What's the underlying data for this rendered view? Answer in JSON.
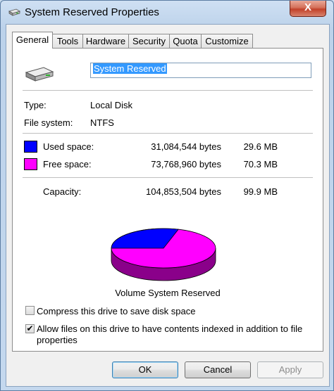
{
  "window": {
    "title": "System Reserved Properties",
    "close_glyph": "X"
  },
  "tabs": [
    {
      "label": "General",
      "active": true
    },
    {
      "label": "Tools"
    },
    {
      "label": "Hardware"
    },
    {
      "label": "Security"
    },
    {
      "label": "Quota"
    },
    {
      "label": "Customize"
    }
  ],
  "general": {
    "drive_name": "System Reserved",
    "type_label": "Type:",
    "type_value": "Local Disk",
    "fs_label": "File system:",
    "fs_value": "NTFS",
    "used": {
      "label": "Used space:",
      "bytes": "31,084,544 bytes",
      "size": "29.6 MB",
      "color": "#0000ff",
      "fraction": 0.296
    },
    "free": {
      "label": "Free space:",
      "bytes": "73,768,960 bytes",
      "size": "70.3 MB",
      "color": "#ff00ff",
      "fraction": 0.704
    },
    "capacity": {
      "label": "Capacity:",
      "bytes": "104,853,504 bytes",
      "size": "99.9 MB"
    },
    "volume_caption": "Volume System Reserved",
    "compress": {
      "label": "Compress this drive to save disk space",
      "checked": false
    },
    "index": {
      "label_line1": "Allow files on this drive to have contents indexed in addition to file",
      "label_line2": "properties",
      "checked": true
    }
  },
  "buttons": {
    "ok": "OK",
    "cancel": "Cancel",
    "apply": "Apply"
  },
  "icons": {
    "title": "drive-icon",
    "panel": "drive-icon"
  }
}
